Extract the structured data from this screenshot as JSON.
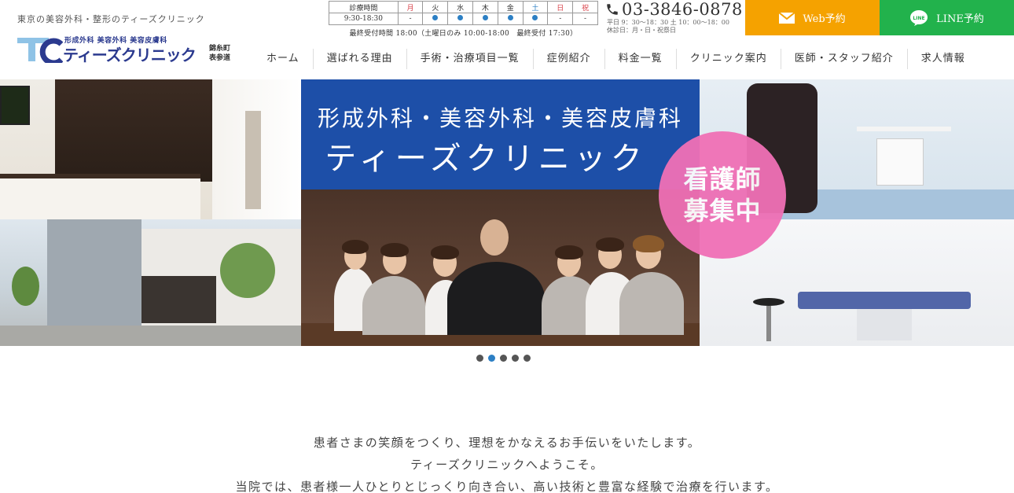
{
  "header": {
    "tagline": "東京の美容外科・整形のティーズクリニック",
    "logo": {
      "subtitle": "形成外科 美容外科 美容皮膚科",
      "name": "ティーズクリニック",
      "location_1": "錦糸町",
      "location_2": "表参道"
    },
    "hours": {
      "label_header": "診療時間",
      "label_time": "9:30-18:30",
      "days": [
        "月",
        "火",
        "水",
        "木",
        "金",
        "土",
        "日",
        "祝"
      ],
      "row2": [
        "-",
        "●",
        "●",
        "●",
        "●",
        "●",
        "-",
        "-"
      ],
      "note": "最終受付時間 18:00（土曜日のみ 10:00-18:00　最終受付 17:30）"
    },
    "phone": {
      "number": "03-3846-0878",
      "sub_1": "平日 9：30〜18：30 土 10：00〜18：00",
      "sub_2": "休診日：月・日・祝祭日"
    },
    "cta": {
      "web_label": "Web予約",
      "line_label": "LINE予約"
    },
    "nav": [
      "ホーム",
      "選ばれる理由",
      "手術・治療項目一覧",
      "症例紹介",
      "料金一覧",
      "クリニック案内",
      "医師・スタッフ紹介",
      "求人情報"
    ]
  },
  "hero": {
    "banner_line1": "形成外科・美容外科・美容皮膚科",
    "banner_line2": "ティーズクリニック",
    "recruit_line1": "看護師",
    "recruit_line2": "募集中",
    "slides_total": 5,
    "slides_active": 2
  },
  "intro": {
    "line1": "患者さまの笑顔をつくり、理想をかなえるお手伝いをいたします。",
    "line2": "ティーズクリニックへようこそ。",
    "line3": "当院では、患者様一人ひとりとじっくり向き合い、高い技術と豊富な経験で治療を行います。"
  },
  "colors": {
    "brand_blue": "#2b3a8f",
    "accent_blue": "#2c7fc4",
    "web_button": "#f5a200",
    "line_button": "#22b24c",
    "recruit_pink": "#f070b6",
    "banner_blue": "#1d4fa8"
  }
}
